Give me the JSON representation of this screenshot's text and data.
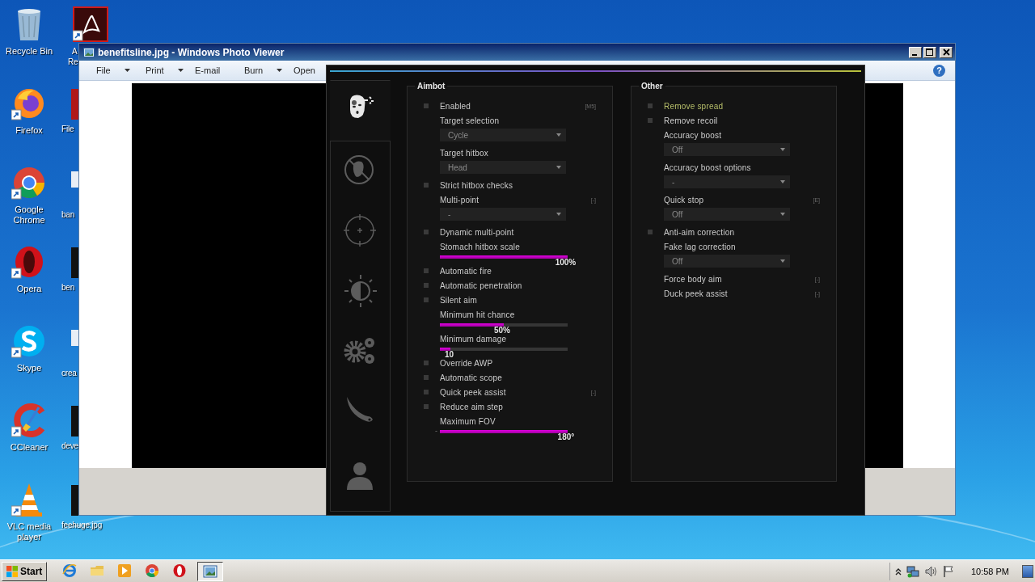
{
  "desktop": {
    "icons": [
      {
        "kind": "recycle",
        "lines": [
          "Recycle Bin"
        ]
      },
      {
        "kind": "firefox",
        "lines": [
          "Firefox"
        ]
      },
      {
        "kind": "chrome",
        "lines": [
          "Google",
          "Chrome"
        ]
      },
      {
        "kind": "opera",
        "lines": [
          "Opera"
        ]
      },
      {
        "kind": "skype",
        "lines": [
          "Skype"
        ]
      },
      {
        "kind": "ccleaner",
        "lines": [
          "CCleaner"
        ]
      },
      {
        "kind": "vlc",
        "lines": [
          "VLC media",
          "player"
        ]
      }
    ],
    "partial_icons": [
      {
        "kind": "acrobat",
        "lines": [
          "A",
          "Re"
        ]
      },
      {
        "kind": "red",
        "lines": [
          "File"
        ]
      },
      {
        "kind": "doc",
        "lines": [
          "ban"
        ]
      },
      {
        "kind": "black",
        "lines": [
          "ben"
        ]
      },
      {
        "kind": "doc",
        "lines": [
          "crea"
        ]
      },
      {
        "kind": "black",
        "lines": [
          "deve"
        ]
      },
      {
        "kind": "black",
        "lines": [
          "feehuge.jpg"
        ]
      }
    ]
  },
  "photo_viewer": {
    "title": "benefitsline.jpg - Windows Photo Viewer",
    "menu": [
      {
        "label": "File",
        "dropdown": true
      },
      {
        "label": "Print",
        "dropdown": true
      },
      {
        "label": "E-mail",
        "dropdown": false
      },
      {
        "label": "Burn",
        "dropdown": true
      },
      {
        "label": "Open",
        "dropdown": false
      }
    ],
    "help": "?"
  },
  "cheat": {
    "tabs": [
      {
        "kind": "rage",
        "selected": true
      },
      {
        "kind": "antiaim",
        "selected": false
      },
      {
        "kind": "crosshair",
        "selected": false
      },
      {
        "kind": "visuals",
        "selected": false
      },
      {
        "kind": "misc",
        "selected": false
      },
      {
        "kind": "knife",
        "selected": false
      },
      {
        "kind": "player",
        "selected": false
      }
    ],
    "groups": [
      {
        "title": "Aimbot",
        "items": [
          {
            "kind": "checkbox",
            "label": "Enabled",
            "checked": false,
            "highlighted": false,
            "key": "[M5]"
          },
          {
            "kind": "label",
            "label": "Target selection"
          },
          {
            "kind": "dropdown",
            "value": "Cycle"
          },
          {
            "kind": "label",
            "label": "Target hitbox"
          },
          {
            "kind": "dropdown",
            "value": "Head"
          },
          {
            "kind": "checkbox",
            "label": "Strict hitbox checks",
            "checked": false,
            "highlighted": false
          },
          {
            "kind": "label",
            "label": "Multi-point",
            "key": "[-]"
          },
          {
            "kind": "dropdown",
            "value": "-"
          },
          {
            "kind": "checkbox",
            "label": "Dynamic multi-point",
            "checked": false,
            "highlighted": false
          },
          {
            "kind": "label",
            "label": "Stomach hitbox scale"
          },
          {
            "kind": "slider",
            "level": 1.0,
            "reading": "100%"
          },
          {
            "kind": "checkbox",
            "label": "Automatic fire",
            "checked": false,
            "highlighted": false
          },
          {
            "kind": "checkbox",
            "label": "Automatic penetration",
            "checked": false,
            "highlighted": false
          },
          {
            "kind": "checkbox",
            "label": "Silent aim",
            "checked": false,
            "highlighted": false
          },
          {
            "kind": "label",
            "label": "Minimum hit chance"
          },
          {
            "kind": "slider",
            "level": 0.5,
            "reading": "50%"
          },
          {
            "kind": "label",
            "label": "Minimum damage"
          },
          {
            "kind": "slider",
            "level": 0.08,
            "reading": "10"
          },
          {
            "kind": "checkbox",
            "label": "Override AWP",
            "checked": false,
            "highlighted": false
          },
          {
            "kind": "checkbox",
            "label": "Automatic scope",
            "checked": false,
            "highlighted": false
          },
          {
            "kind": "checkbox",
            "label": "Quick peek assist",
            "checked": false,
            "highlighted": false,
            "key": "[-]"
          },
          {
            "kind": "checkbox",
            "label": "Reduce aim step",
            "checked": false,
            "highlighted": false
          },
          {
            "kind": "label",
            "label": "Maximum FOV"
          },
          {
            "kind": "slider",
            "level": 1.0,
            "reading": "180°",
            "prefix": "-"
          }
        ]
      },
      {
        "title": "Other",
        "items": [
          {
            "kind": "checkbox",
            "label": "Remove spread",
            "checked": false,
            "highlighted": true
          },
          {
            "kind": "checkbox",
            "label": "Remove recoil",
            "checked": false,
            "highlighted": false
          },
          {
            "kind": "label",
            "label": "Accuracy boost"
          },
          {
            "kind": "dropdown",
            "value": "Off"
          },
          {
            "kind": "label",
            "label": "Accuracy boost options"
          },
          {
            "kind": "dropdown",
            "value": "-"
          },
          {
            "kind": "label",
            "label": "Quick stop",
            "key": "[E]"
          },
          {
            "kind": "dropdown",
            "value": "Off"
          },
          {
            "kind": "checkbox",
            "label": "Anti-aim correction",
            "checked": false,
            "highlighted": false
          },
          {
            "kind": "label",
            "label": "Fake lag correction"
          },
          {
            "kind": "dropdown",
            "value": "Off"
          },
          {
            "kind": "label",
            "label": "Force body aim",
            "key": "[-]"
          },
          {
            "kind": "label",
            "label": "Duck peek assist",
            "key": "[-]"
          }
        ]
      }
    ]
  },
  "taskbar": {
    "start": "Start",
    "apps": [
      {
        "kind": "ie",
        "active": false
      },
      {
        "kind": "explorer",
        "active": false
      },
      {
        "kind": "media",
        "active": false
      },
      {
        "kind": "chrome",
        "active": false
      },
      {
        "kind": "opera",
        "active": false
      },
      {
        "kind": "photos",
        "active": true
      }
    ],
    "tray": [
      {
        "kind": "arrow"
      },
      {
        "kind": "network"
      },
      {
        "kind": "volume"
      },
      {
        "kind": "flag"
      }
    ],
    "clock": "10:58 PM"
  }
}
